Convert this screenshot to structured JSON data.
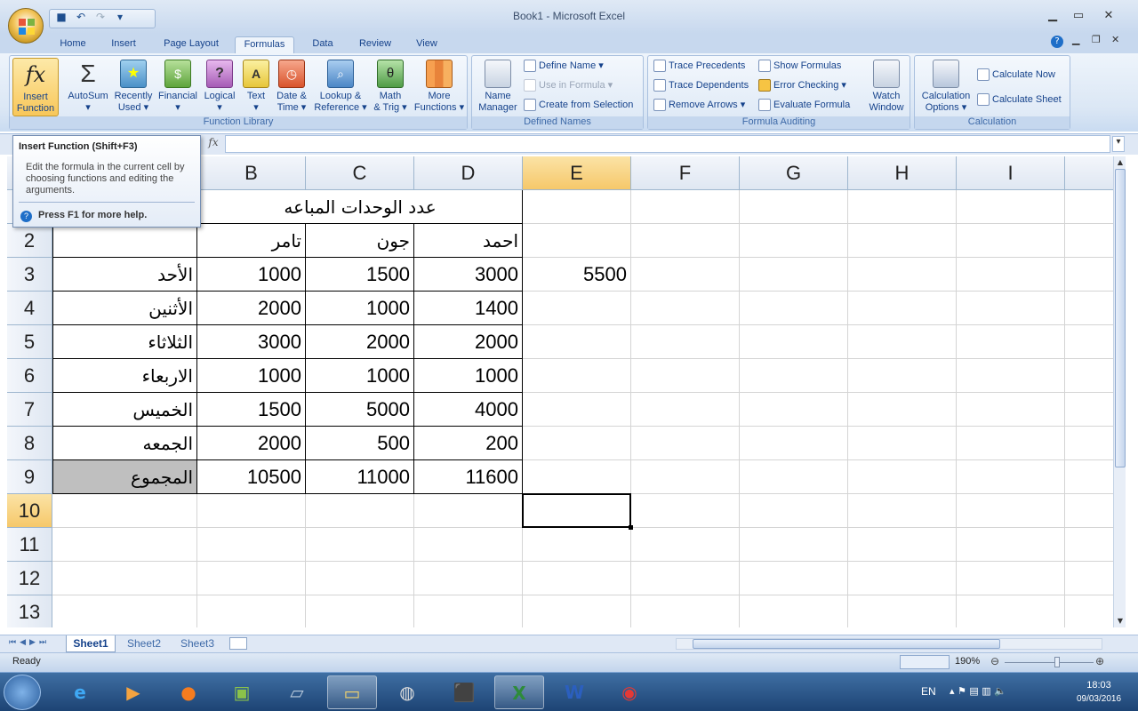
{
  "window": {
    "title": "Book1 - Microsoft Excel"
  },
  "ribbon_tabs": [
    "Home",
    "Insert",
    "Page Layout",
    "Formulas",
    "Data",
    "Review",
    "View"
  ],
  "active_tab": "Formulas",
  "function_library": {
    "label": "Function Library",
    "buttons": [
      {
        "l1": "Insert",
        "l2": "Function",
        "icon": "fx-icon"
      },
      {
        "l1": "AutoSum",
        "l2": "▾",
        "icon": "sigma-icon"
      },
      {
        "l1": "Recently",
        "l2": "Used ▾",
        "icon": "book-star-icon"
      },
      {
        "l1": "Financial",
        "l2": "▾",
        "icon": "book-money-icon"
      },
      {
        "l1": "Logical",
        "l2": "▾",
        "icon": "book-question-icon"
      },
      {
        "l1": "Text",
        "l2": "▾",
        "icon": "book-a-icon"
      },
      {
        "l1": "Date &",
        "l2": "Time ▾",
        "icon": "book-clock-icon"
      },
      {
        "l1": "Lookup &",
        "l2": "Reference ▾",
        "icon": "book-search-icon"
      },
      {
        "l1": "Math",
        "l2": "& Trig ▾",
        "icon": "book-theta-icon"
      },
      {
        "l1": "More",
        "l2": "Functions ▾",
        "icon": "books-icon"
      }
    ]
  },
  "defined_names": {
    "label": "Defined Names",
    "name_manager": {
      "l1": "Name",
      "l2": "Manager"
    },
    "define_name": "Define Name ▾",
    "use_in_formula": "Use in Formula ▾",
    "create_from_selection": "Create from Selection"
  },
  "formula_auditing": {
    "label": "Formula Auditing",
    "trace_precedents": "Trace Precedents",
    "trace_dependents": "Trace Dependents",
    "remove_arrows": "Remove Arrows ▾",
    "show_formulas": "Show Formulas",
    "error_checking": "Error Checking ▾",
    "evaluate_formula": "Evaluate Formula",
    "watch_window": {
      "l1": "Watch",
      "l2": "Window"
    }
  },
  "calculation": {
    "label": "Calculation",
    "options": {
      "l1": "Calculation",
      "l2": "Options ▾"
    },
    "calculate_now": "Calculate Now",
    "calculate_sheet": "Calculate Sheet"
  },
  "formula_bar": {
    "fx": "fx",
    "value": ""
  },
  "tooltip": {
    "title": "Insert Function (Shift+F3)",
    "body": "Edit the formula in the current cell by choosing functions and editing the arguments.",
    "help": "Press F1 for more help."
  },
  "columns": [
    "B",
    "C",
    "D",
    "E",
    "F",
    "G",
    "H",
    "I"
  ],
  "rows": [
    "2",
    "3",
    "4",
    "5",
    "6",
    "7",
    "8",
    "9",
    "10",
    "11",
    "12",
    "13"
  ],
  "sheet": {
    "title_merged": "عدد الوحدات المباعه",
    "headers": [
      "تامر",
      "جون",
      "احمد"
    ],
    "days": [
      "الأحد",
      "الأثنين",
      "الثلاثاء",
      "الاربعاء",
      "الخميس",
      "الجمعه",
      "المجموع"
    ],
    "values": [
      [
        "1000",
        "1500",
        "3000"
      ],
      [
        "2000",
        "1000",
        "1400"
      ],
      [
        "3000",
        "2000",
        "2000"
      ],
      [
        "1000",
        "1000",
        "1000"
      ],
      [
        "1500",
        "5000",
        "4000"
      ],
      [
        "2000",
        "500",
        "200"
      ],
      [
        "10500",
        "11000",
        "11600"
      ]
    ],
    "e3": "5500"
  },
  "sheet_tabs": [
    "Sheet1",
    "Sheet2",
    "Sheet3"
  ],
  "status": {
    "ready": "Ready",
    "zoom": "190%"
  },
  "taskbar": {
    "lang": "EN",
    "time": "18:03",
    "date": "09/03/2016"
  }
}
